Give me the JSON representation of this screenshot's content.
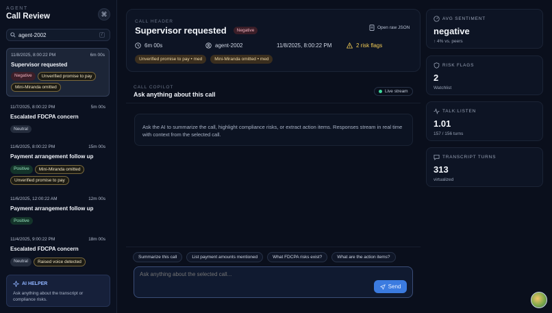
{
  "app": {
    "eyebrow": "AGENT",
    "title": "Call Review",
    "cmd_icon": "command-icon"
  },
  "search": {
    "value": "agent-2002",
    "kbd": "/"
  },
  "calls": [
    {
      "time": "11/8/2025, 8:00:22 PM",
      "duration": "6m 00s",
      "title": "Supervisor requested",
      "tags": [
        {
          "label": "Negative",
          "kind": "neg"
        },
        {
          "label": "Unverified promise to pay",
          "kind": "warn"
        },
        {
          "label": "Mini-Miranda omitted",
          "kind": "warn"
        }
      ]
    },
    {
      "time": "11/7/2025, 8:00:22 PM",
      "duration": "5m 00s",
      "title": "Escalated FDCPA concern",
      "tags": [
        {
          "label": "Neutral",
          "kind": "neu"
        }
      ]
    },
    {
      "time": "11/6/2025, 8:00:22 PM",
      "duration": "15m 00s",
      "title": "Payment arrangement follow up",
      "tags": [
        {
          "label": "Positive",
          "kind": "pos"
        },
        {
          "label": "Mini-Miranda omitted",
          "kind": "warn"
        },
        {
          "label": "Unverified promise to pay",
          "kind": "warn"
        }
      ]
    },
    {
      "time": "11/6/2025, 12:00:22 AM",
      "duration": "12m 00s",
      "title": "Payment arrangement follow up",
      "tags": [
        {
          "label": "Positive",
          "kind": "pos"
        }
      ]
    },
    {
      "time": "11/4/2025, 9:00:22 PM",
      "duration": "18m 00s",
      "title": "Escalated FDCPA concern",
      "tags": [
        {
          "label": "Neutral",
          "kind": "neu"
        },
        {
          "label": "Raised voice detected",
          "kind": "warn"
        }
      ]
    }
  ],
  "ai_helper": {
    "title": "AI HELPER",
    "desc": "Ask anything about the transcript or compliance risks."
  },
  "call_header": {
    "eyebrow": "CALL HEADER",
    "title": "Supervisor requested",
    "sentiment_badge": "Negative",
    "open_json": "Open raw JSON",
    "duration": "6m 00s",
    "agent": "agent-2002",
    "datetime": "11/8/2025, 8:00:22 PM",
    "risk_flags": "2 risk flags",
    "chips": [
      "Unverified promise to pay • med",
      "Mini-Miranda omitted • med"
    ]
  },
  "copilot": {
    "eyebrow": "CALL COPILOT",
    "title": "Ask anything about this call",
    "live": "Live stream",
    "intro": "Ask the AI to summarize the call, highlight compliance risks, or extract action items. Responses stream in real time with context from the selected call.",
    "quick_prompts": [
      "Summarize this call",
      "List payment amounts mentioned",
      "What FDCPA risks exist?",
      "What are the action items?"
    ],
    "placeholder": "Ask anything about the selected call...",
    "send": "Send"
  },
  "stats": {
    "sentiment": {
      "label": "AVG SENTIMENT",
      "value": "negative",
      "sub": "↑ 4% vs. peers"
    },
    "risk": {
      "label": "RISK FLAGS",
      "value": "2",
      "sub": "Watchlist"
    },
    "talk": {
      "label": "TALK:LISTEN",
      "value": "1.01",
      "sub": "157 / 156 turns"
    },
    "turns": {
      "label": "TRANSCRIPT TURNS",
      "value": "313",
      "sub": "virtualized"
    }
  },
  "colors": {
    "accent": "#3b7be0",
    "negative": "#f2b3c0",
    "positive": "#98e5c0",
    "warning": "#f3cc55",
    "live": "#3ed69a"
  }
}
